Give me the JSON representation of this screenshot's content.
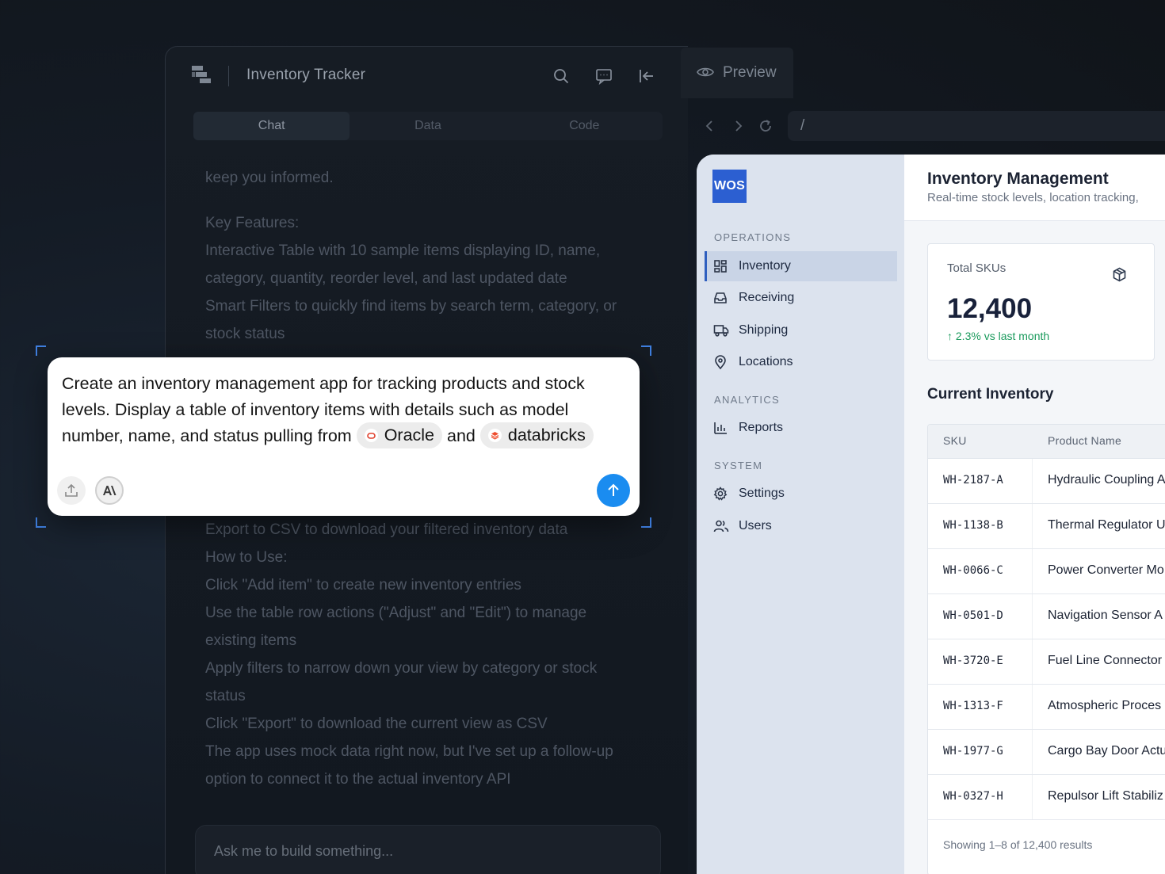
{
  "builder": {
    "title": "Inventory Tracker",
    "tabs": [
      {
        "label": "Chat",
        "active": true
      },
      {
        "label": "Data",
        "active": false
      },
      {
        "label": "Code",
        "active": false
      }
    ],
    "chat_lines_top": [
      "keep you informed.",
      "Key Features:",
      "Interactive Table with 10 sample items displaying ID, name,",
      "category, quantity, reorder level, and last updated date",
      "Smart Filters to quickly find items by search term, category, or",
      "stock status"
    ],
    "chat_lines_bottom": [
      "Export to CSV to download your filtered inventory data",
      "How to Use:",
      "Click \"Add item\" to create new inventory entries",
      "Use the table row actions (\"Adjust\" and \"Edit\") to manage",
      "existing items",
      "Apply filters to narrow down your view by category or stock",
      "status",
      "Click \"Export\" to download the current view as CSV",
      "The app uses mock data right now, but I've set up a follow-up",
      "option to connect it to the actual inventory API"
    ],
    "input_placeholder": "Ask me to build something..."
  },
  "preview": {
    "tab_label": "Preview",
    "url": "/"
  },
  "app": {
    "logo": "WOS",
    "sections": [
      {
        "label": "OPERATIONS",
        "items": [
          {
            "label": "Inventory",
            "icon": "grid-icon",
            "active": true
          },
          {
            "label": "Receiving",
            "icon": "inbox-icon",
            "active": false
          },
          {
            "label": "Shipping",
            "icon": "truck-icon",
            "active": false
          },
          {
            "label": "Locations",
            "icon": "map-pin-icon",
            "active": false
          }
        ]
      },
      {
        "label": "ANALYTICS",
        "items": [
          {
            "label": "Reports",
            "icon": "bar-chart-icon",
            "active": false
          }
        ]
      },
      {
        "label": "SYSTEM",
        "items": [
          {
            "label": "Settings",
            "icon": "gear-icon",
            "active": false
          },
          {
            "label": "Users",
            "icon": "users-icon",
            "active": false
          }
        ]
      }
    ],
    "header": {
      "title": "Inventory Management",
      "subtitle": "Real-time stock levels, location tracking,"
    },
    "stat_card": {
      "label": "Total SKUs",
      "value": "12,400",
      "delta": "↑ 2.3% vs last month",
      "icon": "box-icon"
    },
    "table": {
      "title": "Current Inventory",
      "columns": [
        "SKU",
        "Product Name"
      ],
      "rows": [
        {
          "sku": "WH-2187-A",
          "name": "Hydraulic Coupling A"
        },
        {
          "sku": "WH-1138-B",
          "name": "Thermal Regulator U"
        },
        {
          "sku": "WH-0066-C",
          "name": "Power Converter Mo"
        },
        {
          "sku": "WH-0501-D",
          "name": "Navigation Sensor A"
        },
        {
          "sku": "WH-3720-E",
          "name": "Fuel Line Connector"
        },
        {
          "sku": "WH-1313-F",
          "name": "Atmospheric Proces"
        },
        {
          "sku": "WH-1977-G",
          "name": "Cargo Bay Door Actu"
        },
        {
          "sku": "WH-0327-H",
          "name": "Repulsor Lift Stabiliz"
        }
      ],
      "footer": "Showing 1–8 of 12,400 results"
    }
  },
  "prompt": {
    "line1": "Create an inventory management app for tracking products and stock",
    "line2": "levels. Display a table of inventory items with details such as model",
    "line3_prefix": "number, name, and status pulling from",
    "chip1": "Oracle",
    "connector": "and",
    "chip2": "databricks"
  },
  "colors": {
    "accent_blue": "#1a8cf0",
    "logo_blue": "#2c5fd1",
    "positive_green": "#1a9a5c",
    "oracle_red": "#e0422f",
    "databricks_orange": "#ee4c2c"
  }
}
